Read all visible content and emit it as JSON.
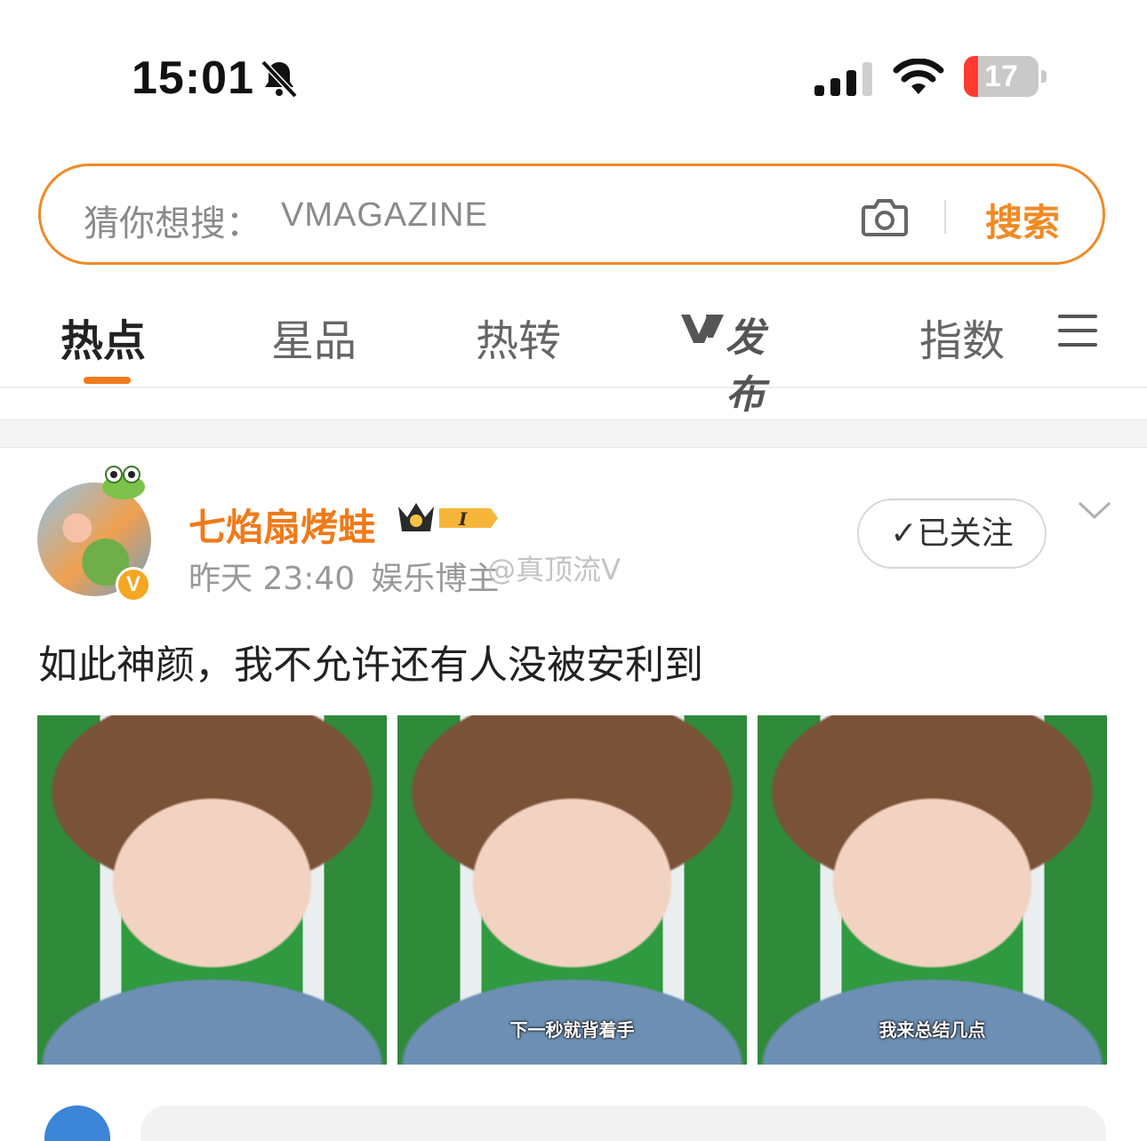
{
  "status_bar": {
    "time": "15:01",
    "battery": "17",
    "battery_color": "#ff3b30"
  },
  "search": {
    "prefix": "猜你想搜：",
    "term": "VMAGAZINE",
    "button": "搜索",
    "accent": "#f08a24"
  },
  "tabs": [
    {
      "label": "热点",
      "active": true
    },
    {
      "label": "星品"
    },
    {
      "label": "热转"
    },
    {
      "label": "发布",
      "icon": "v-logo"
    },
    {
      "label": "指数"
    }
  ],
  "post": {
    "username": "七焰扇烤蛙",
    "badge_level": "I",
    "time": "昨天 23:40",
    "source": "娱乐博主",
    "watermark": "@真顶流V",
    "follow_label": "✓已关注",
    "text": "如此神颜，我不允许还有人没被安利到",
    "images": [
      {
        "caption": ""
      },
      {
        "caption": "下一秒就背着手"
      },
      {
        "caption": "我来总结几点"
      }
    ]
  }
}
